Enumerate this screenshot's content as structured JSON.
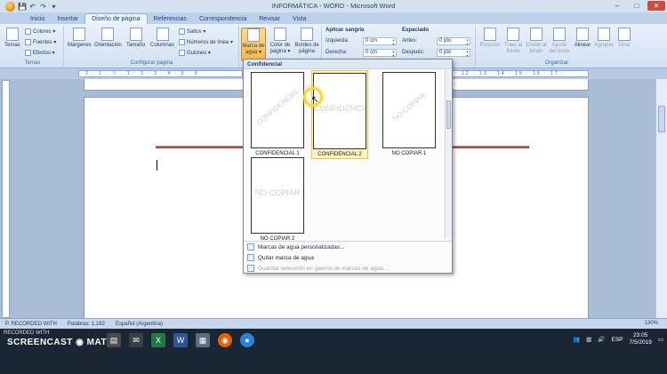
{
  "window": {
    "title": "INFORMÁTICA - WORD - Microsoft Word",
    "controls": {
      "minimize": "–",
      "maximize": "□",
      "close": "✕"
    }
  },
  "qat": {
    "save": "💾",
    "undo": "↶",
    "redo": "↷",
    "more": "▾"
  },
  "tabs": [
    {
      "label": "Inicio"
    },
    {
      "label": "Insertar"
    },
    {
      "label": "Diseño de página",
      "active": true
    },
    {
      "label": "Referencias"
    },
    {
      "label": "Correspondencia"
    },
    {
      "label": "Revisar"
    },
    {
      "label": "Vista"
    }
  ],
  "ribbon": {
    "temas": {
      "label": "Temas",
      "temas_btn": "Temas",
      "colores": "Colores ▾",
      "fuentes": "Fuentes ▾",
      "efectos": "Efectos ▾"
    },
    "configurar": {
      "label": "Configurar página",
      "margenes": "Márgenes",
      "orientacion": "Orientación",
      "tamano": "Tamaño",
      "columnas": "Columnas",
      "saltos": "Saltos ▾",
      "numeros_linea": "Números de línea ▾",
      "guiones": "Guiones ▾"
    },
    "fondo": {
      "marca_agua": "Marca de agua ▾",
      "color_pagina": "Color de página ▾",
      "bordes_pagina": "Bordes de página"
    },
    "parrafo": {
      "aplicar_sangria": "Aplicar sangría",
      "izquierda_label": "Izquierda:",
      "izquierda_value": "0 cm",
      "derecha_label": "Derecha:",
      "derecha_value": "0 cm",
      "espaciado": "Espaciado",
      "antes_label": "Antes:",
      "antes_value": "0 pto",
      "despues_label": "Después:",
      "despues_value": "0 pto"
    },
    "organizar": {
      "label": "Organizar",
      "posicion": "Posición",
      "traer_frente": "Traer al frente",
      "enviar_fondo": "Enviar al fondo",
      "ajuste_texto": "Ajuste del texto",
      "alinear": "Alinear",
      "agrupar": "Agrupar",
      "girar": "Girar"
    }
  },
  "ruler": {
    "left_marks": "· 2 · 1 · ▽ · 1 · 2 · 3 · 4 · 5 · 6",
    "right_marks": "· 12 · 13 · 14 · 15 · 16 · 17 ·"
  },
  "gallery": {
    "heading": "Confidencial",
    "items": [
      {
        "caption": "CONFIDENCIAL 1",
        "watermark": "CONFIDENCIAL",
        "diagonal": true,
        "selected": false
      },
      {
        "caption": "CONFIDENCIAL 2",
        "watermark": "CONFIDENCIAL",
        "diagonal": false,
        "selected": true
      },
      {
        "caption": "NO COPIAR 1",
        "watermark": "NO COPIAR",
        "diagonal": true,
        "selected": false
      },
      {
        "caption": "NO COPIAR 2",
        "watermark": "NO COPIAR",
        "diagonal": false,
        "selected": false
      }
    ],
    "menu": [
      {
        "label": "Marcas de agua personalizadas...",
        "enabled": true
      },
      {
        "label": "Quitar marca de agua",
        "enabled": true
      },
      {
        "label": "Guardar selección en galería de marcas de agua...",
        "enabled": false
      }
    ]
  },
  "statusbar": {
    "page_info": "P. RECORDED WITH",
    "words": "Palabras: 1.182",
    "language": "Español (Argentina)",
    "zoom": "130%"
  },
  "screencast": {
    "recorded": "RECORDED WITH",
    "logo": "SCREENCAST ◉ MATIC"
  },
  "taskbar": {
    "language": "ESP",
    "time": "23:05",
    "date": "7/5/2019"
  },
  "colors": {
    "ribbon_bg": "#d2e1f3",
    "accent": "#15428b",
    "selected_item": "#fff2bf",
    "click_highlight": "#f2dc3a",
    "header_line": "#8e2a2a"
  }
}
